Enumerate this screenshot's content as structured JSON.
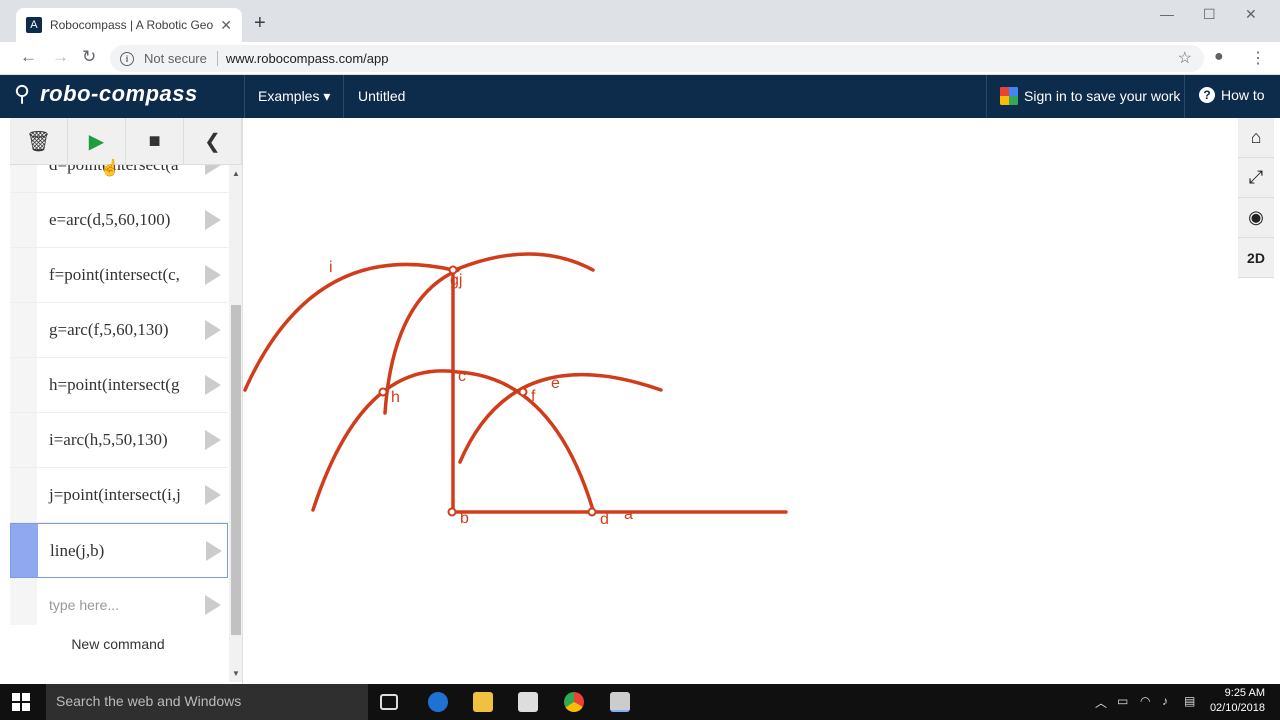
{
  "browser": {
    "tab_title": "Robocompass | A Robotic Geome",
    "tab_favicon": "A",
    "new_tab": "+",
    "security_label": "Not secure",
    "url": "www.robocompass.com/app"
  },
  "header": {
    "brand": "robo-compass",
    "examples": "Examples ▾",
    "doc_title": "Untitled",
    "sign_in": "Sign in to save your work",
    "how_to": "How to"
  },
  "commands": [
    {
      "text": "d=point(intersect(a"
    },
    {
      "text": "e=arc(d,5,60,100)"
    },
    {
      "text": "f=point(intersect(c,"
    },
    {
      "text": "g=arc(f,5,60,130)"
    },
    {
      "text": "h=point(intersect(g"
    },
    {
      "text": "i=arc(h,5,50,130)"
    },
    {
      "text": "j=point(intersect(i,j"
    },
    {
      "text": "line(j,b)"
    }
  ],
  "input_placeholder": "type here...",
  "new_command": "New command",
  "side_tools": {
    "mode": "2D"
  },
  "canvas_labels": [
    "i",
    "gj",
    "c",
    "h",
    "f",
    "e",
    "b",
    "d",
    "a"
  ],
  "taskbar": {
    "search_placeholder": "Search the web and Windows",
    "time": "9:25 AM",
    "date": "02/10/2018"
  },
  "colors": {
    "construction": "#d13c1a",
    "header_bg": "#0d2b4a",
    "active_command": "#8fa8f0"
  },
  "icons": [
    "trash-icon",
    "play-icon",
    "stop-icon",
    "collapse-icon",
    "home-icon",
    "fullscreen-icon",
    "eye-icon",
    "google-icon",
    "help-icon"
  ]
}
